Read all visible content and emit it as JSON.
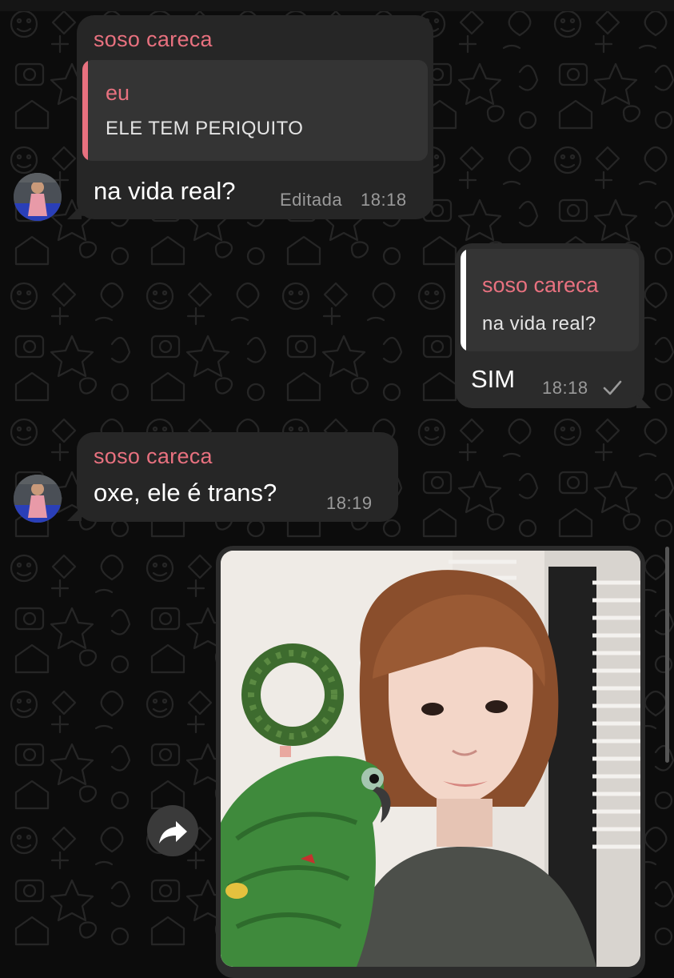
{
  "messages": [
    {
      "id": "msg1",
      "direction": "in",
      "sender": "soso careca",
      "reply_to": {
        "name": "eu",
        "text": "ELE TEM PERIQUITO"
      },
      "text": "na vida real?",
      "edited_label": "Editada",
      "time": "18:18"
    },
    {
      "id": "msg2",
      "direction": "out",
      "reply_to": {
        "name": "soso careca",
        "text": "na vida real?"
      },
      "text": "SIM",
      "time": "18:18",
      "status_icon": "check-icon"
    },
    {
      "id": "msg3",
      "direction": "in",
      "sender": "soso careca",
      "text": "oxe, ele é trans?",
      "time": "18:19"
    },
    {
      "id": "msg4",
      "direction": "out",
      "type": "photo",
      "photo_subject": "person-with-green-parrot-photo"
    }
  ],
  "icons": {
    "forward": "forward-icon",
    "read_status": "check-icon"
  },
  "colors": {
    "background": "#0c0c0c",
    "bubble_in": "#262626",
    "bubble_out": "#2b2b2b",
    "sender_name": "#e8717f",
    "meta_text": "#9a9a9a"
  }
}
